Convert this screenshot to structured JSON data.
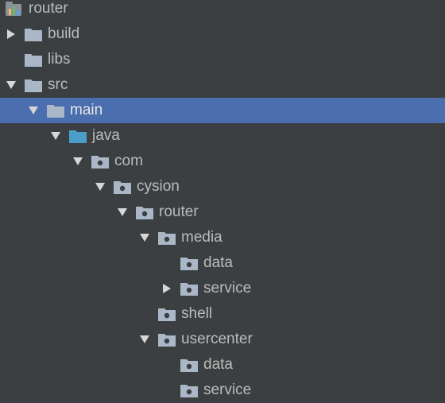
{
  "colors": {
    "background": "#3c3f41",
    "selected_row": "#4b6eaf",
    "text": "#bbbbbb",
    "folder": "#a9b7c6",
    "source_folder": "#4a9ec8"
  },
  "tree": {
    "root": {
      "label": "router",
      "icon": "module-icon"
    },
    "items": [
      {
        "label": "build",
        "icon": "folder-icon",
        "expander": "collapsed"
      },
      {
        "label": "libs",
        "icon": "folder-icon",
        "expander": "none"
      },
      {
        "label": "src",
        "icon": "folder-icon",
        "expander": "expanded"
      },
      {
        "label": "main",
        "icon": "folder-icon",
        "expander": "expanded",
        "selected": true
      },
      {
        "label": "java",
        "icon": "source-folder-icon",
        "expander": "expanded"
      },
      {
        "label": "com",
        "icon": "package-icon",
        "expander": "expanded"
      },
      {
        "label": "cysion",
        "icon": "package-icon",
        "expander": "expanded"
      },
      {
        "label": "router",
        "icon": "package-icon",
        "expander": "expanded"
      },
      {
        "label": "media",
        "icon": "package-icon",
        "expander": "expanded"
      },
      {
        "label": "data",
        "icon": "package-icon",
        "expander": "none"
      },
      {
        "label": "service",
        "icon": "package-icon",
        "expander": "collapsed"
      },
      {
        "label": "shell",
        "icon": "package-icon",
        "expander": "none"
      },
      {
        "label": "usercenter",
        "icon": "package-icon",
        "expander": "expanded"
      },
      {
        "label": "data",
        "icon": "package-icon",
        "expander": "none"
      },
      {
        "label": "service",
        "icon": "package-icon",
        "expander": "none"
      }
    ]
  }
}
